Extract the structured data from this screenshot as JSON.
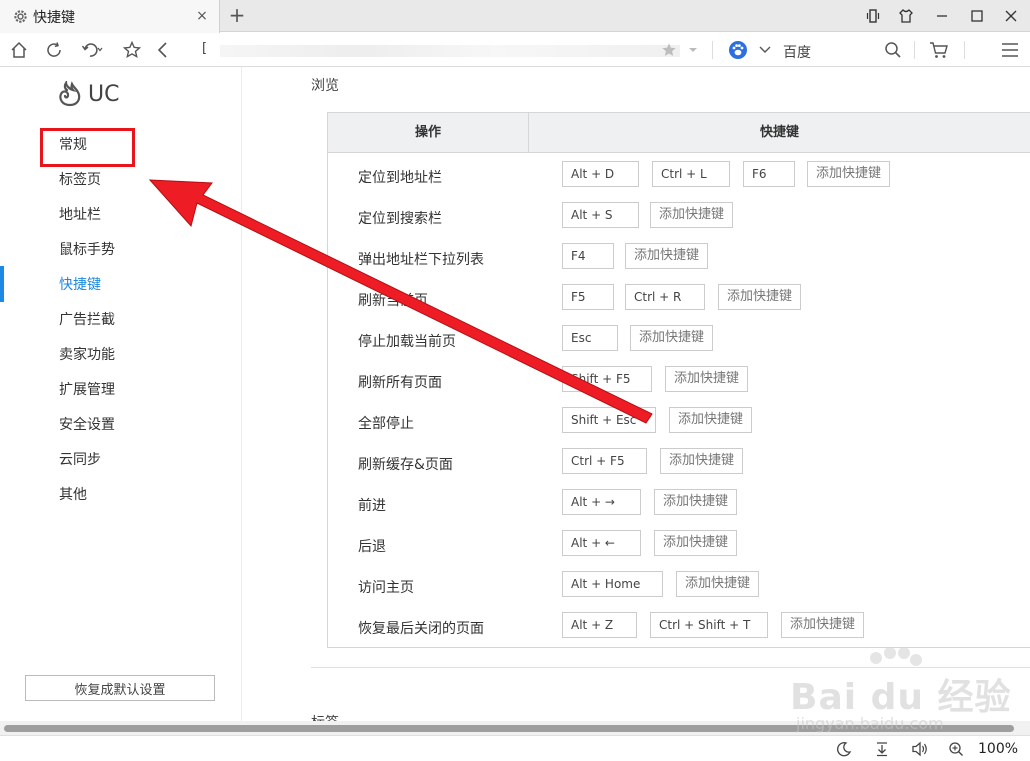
{
  "tab": {
    "title": "快捷键",
    "close": "×",
    "new": "+"
  },
  "address": {
    "bracket": "[",
    "search_engine": "百度"
  },
  "sidebar": {
    "logo": "UC",
    "items": [
      {
        "label": "常规"
      },
      {
        "label": "标签页"
      },
      {
        "label": "地址栏"
      },
      {
        "label": "鼠标手势"
      },
      {
        "label": "快捷键"
      },
      {
        "label": "广告拦截"
      },
      {
        "label": "卖家功能"
      },
      {
        "label": "扩展管理"
      },
      {
        "label": "安全设置"
      },
      {
        "label": "云同步"
      },
      {
        "label": "其他"
      }
    ],
    "active_index": 4,
    "reset_label": "恢复成默认设置"
  },
  "main": {
    "section_title": "浏览",
    "next_section": "标签",
    "headers": {
      "operation": "操作",
      "shortcut": "快捷键"
    },
    "add_label": "添加快捷键",
    "rows": [
      {
        "op": "定位到地址栏",
        "keys": [
          "Alt + D",
          "Ctrl + L",
          "F6"
        ]
      },
      {
        "op": "定位到搜索栏",
        "keys": [
          "Alt + S"
        ]
      },
      {
        "op": "弹出地址栏下拉列表",
        "keys": [
          "F4"
        ]
      },
      {
        "op": "刷新当前页",
        "keys": [
          "F5",
          "Ctrl + R"
        ]
      },
      {
        "op": "停止加载当前页",
        "keys": [
          "Esc"
        ]
      },
      {
        "op": "刷新所有页面",
        "keys": [
          "Shift + F5"
        ]
      },
      {
        "op": "全部停止",
        "keys": [
          "Shift + Esc"
        ]
      },
      {
        "op": "刷新缓存&页面",
        "keys": [
          "Ctrl + F5"
        ]
      },
      {
        "op": "前进",
        "keys": [
          "Alt + →"
        ]
      },
      {
        "op": "后退",
        "keys": [
          "Alt + ←"
        ]
      },
      {
        "op": "访问主页",
        "keys": [
          "Alt + Home"
        ]
      },
      {
        "op": "恢复最后关闭的页面",
        "keys": [
          "Alt + Z",
          "Ctrl + Shift + T"
        ]
      }
    ]
  },
  "status": {
    "zoom": "100%"
  },
  "watermark": {
    "brand": "Bai du 经验",
    "url": "jingyan.baidu.com"
  },
  "colors": {
    "accent": "#1e88e5",
    "annotation": "#e8141c"
  }
}
